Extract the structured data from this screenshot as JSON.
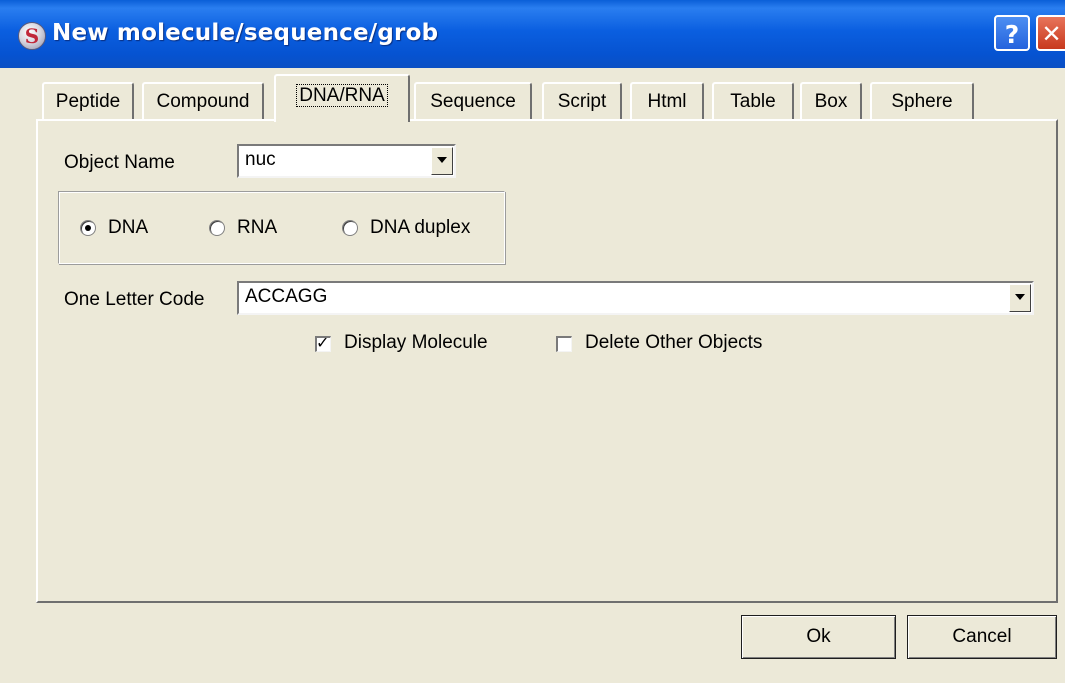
{
  "window": {
    "title": "New molecule/sequence/grob",
    "help_label": "?",
    "close_label": "✕"
  },
  "tabs": [
    {
      "label": "Peptide"
    },
    {
      "label": "Compound"
    },
    {
      "label": "DNA/RNA"
    },
    {
      "label": "Sequence"
    },
    {
      "label": "Script"
    },
    {
      "label": "Html"
    },
    {
      "label": "Table"
    },
    {
      "label": "Box"
    },
    {
      "label": "Sphere"
    }
  ],
  "active_tab": "DNA/RNA",
  "form": {
    "object_name_label": "Object Name",
    "object_name_value": "nuc",
    "molecule_types": [
      {
        "label": "DNA",
        "selected": true
      },
      {
        "label": "RNA",
        "selected": false
      },
      {
        "label": "DNA duplex",
        "selected": false
      }
    ],
    "one_letter_code_label": "One Letter Code",
    "one_letter_code_value": "ACCAGG",
    "display_molecule_label": "Display Molecule",
    "display_molecule_checked": true,
    "delete_other_objects_label": "Delete Other Objects",
    "delete_other_objects_checked": false
  },
  "buttons": {
    "ok_label": "Ok",
    "cancel_label": "Cancel"
  },
  "icons": {
    "app": "app-logo-icon",
    "help": "help-icon",
    "close": "close-icon"
  }
}
